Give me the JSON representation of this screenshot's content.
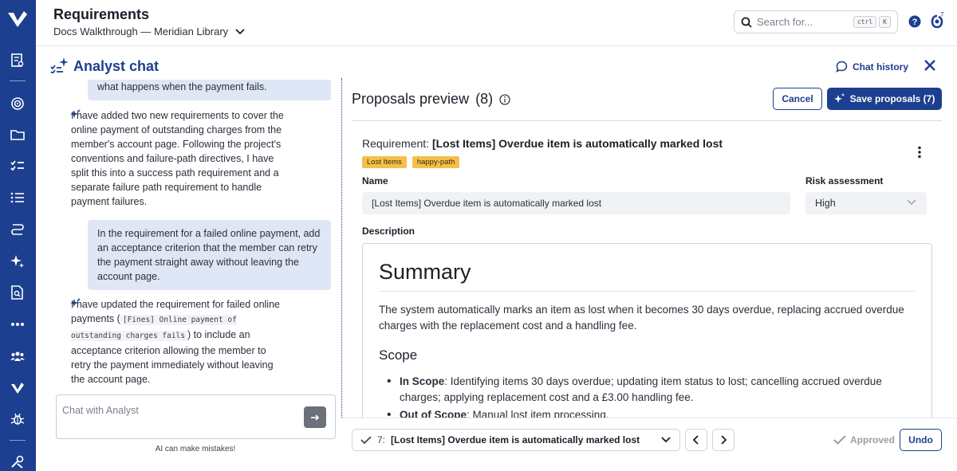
{
  "header": {
    "title": "Requirements",
    "subtitle": "Docs Walkthrough — Meridian Library",
    "search_placeholder": "Search for...",
    "shortcut_ctrl": "ctrl",
    "shortcut_k": "K",
    "notification_count": "7"
  },
  "analyst": {
    "title": "Analyst chat",
    "history_label": "Chat history"
  },
  "chat": {
    "messages": [
      {
        "role": "user",
        "text": "what happens when the payment fails."
      },
      {
        "role": "assistant",
        "text": "I have added two new requirements to cover the online payment of outstanding charges from the member's account page. Following the project's conventions and failure-path directives, I have split this into a success path requirement and a separate failure path requirement to handle payment failures."
      },
      {
        "role": "user",
        "text": "In the requirement for a failed online payment, add an acceptance criterion that the member can retry the payment straight away without leaving the account page."
      },
      {
        "role": "assistant",
        "text_before": "I have updated the requirement for failed online payments (",
        "code": "[Fines] Online payment of outstanding charges fails",
        "text_after": ") to include an acceptance criterion allowing the member to retry the payment immediately without leaving the account page."
      }
    ],
    "input_placeholder": "Chat with Analyst",
    "disclaimer": "AI can make mistakes!"
  },
  "proposals": {
    "title": "Proposals preview",
    "count": "(8)",
    "cancel_label": "Cancel",
    "save_label": "Save proposals (7)",
    "requirement_prefix": "Requirement:",
    "requirement_title": "[Lost Items] Overdue item is automatically marked lost",
    "tags": [
      "Lost Items",
      "happy-path"
    ],
    "name_label": "Name",
    "name_value": "[Lost Items] Overdue item is automatically marked lost",
    "risk_label": "Risk assessment",
    "risk_value": "High",
    "description_label": "Description",
    "description": {
      "heading": "Summary",
      "paragraph": "The system automatically marks an item as lost when it becomes 30 days overdue, replacing accrued overdue charges with the replacement cost and a handling fee.",
      "scope_heading": "Scope",
      "scope_items": [
        {
          "label": "In Scope",
          "text": ": Identifying items 30 days overdue; updating item status to lost; cancelling accrued overdue charges; applying replacement cost and a £3.00 handling fee."
        },
        {
          "label": "Out of Scope",
          "text": ": Manual lost item processing."
        }
      ]
    }
  },
  "bottom": {
    "index": "7:",
    "selected": "[Lost Items] Overdue item is automatically marked lost",
    "status": "Approved",
    "undo_label": "Undo"
  },
  "colors": {
    "brand": "#1d3f8f",
    "tag": "#f4c04a",
    "user_bubble": "#dfe7f7"
  }
}
